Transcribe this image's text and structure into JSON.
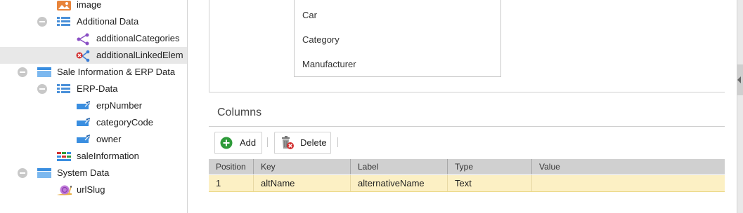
{
  "tree": {
    "items": [
      {
        "label": "image",
        "icon": "image-icon"
      },
      {
        "label": "Additional Data",
        "icon": "field-list-icon"
      },
      {
        "label": "additionalCategories",
        "icon": "relation-icon"
      },
      {
        "label": "additionalLinkedElem",
        "icon": "relation-error-icon"
      },
      {
        "label": "Sale Information & ERP Data",
        "icon": "panel-icon"
      },
      {
        "label": "ERP-Data",
        "icon": "field-list-icon"
      },
      {
        "label": "erpNumber",
        "icon": "input-field-icon"
      },
      {
        "label": "categoryCode",
        "icon": "input-field-icon"
      },
      {
        "label": "owner",
        "icon": "input-field-icon"
      },
      {
        "label": "saleInformation",
        "icon": "structured-table-icon"
      },
      {
        "label": "System Data",
        "icon": "panel-icon"
      },
      {
        "label": "urlSlug",
        "icon": "snail-icon"
      }
    ]
  },
  "classes_list": {
    "options": [
      "Car",
      "Category",
      "Manufacturer"
    ]
  },
  "columns": {
    "title": "Columns",
    "add_label": "Add",
    "delete_label": "Delete",
    "headers": [
      "Position",
      "Key",
      "Label",
      "Type",
      "Value"
    ],
    "rows": [
      {
        "position": "1",
        "key": "altName",
        "label": "alternativeName",
        "type": "Text",
        "value": ""
      }
    ]
  },
  "colors": {
    "selected_row": "#fcf0c4",
    "header_bg": "#d0d0d0",
    "add_green": "#2e9b3a",
    "delete_red": "#d23030"
  }
}
